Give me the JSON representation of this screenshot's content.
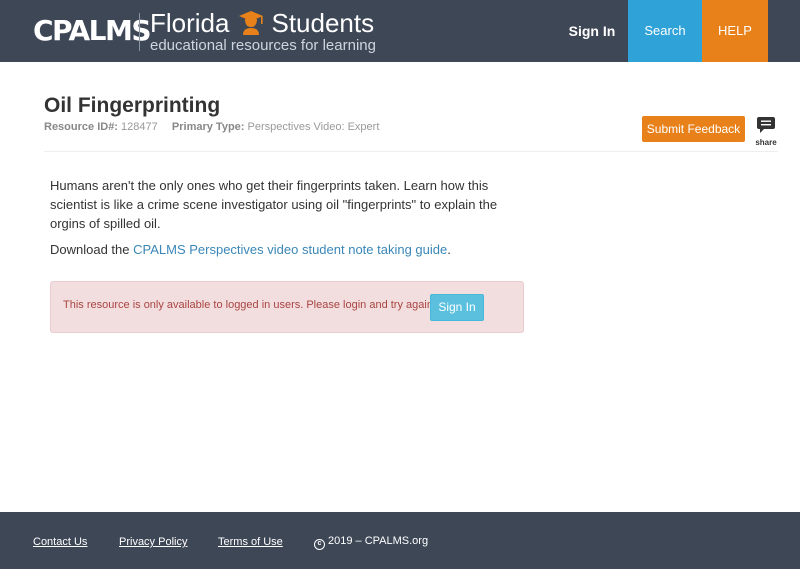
{
  "header": {
    "logo_text": "CPALMS",
    "brand_title_left": "Florida",
    "brand_title_right": "Students",
    "brand_subtitle": "educational resources for learning",
    "nav": {
      "sign_in": "Sign In",
      "search": "Search",
      "help": "HELP"
    }
  },
  "resource": {
    "title": "Oil Fingerprinting",
    "id_label": "Resource ID#:",
    "id_value": "128477",
    "type_label": "Primary Type:",
    "type_value": "Perspectives Video: Expert",
    "feedback_button": "Submit Feedback",
    "share_label": "share",
    "description": "Humans aren't the only ones who get their fingerprints taken. Learn how this scientist is like a crime scene investigator using oil \"fingerprints\" to explain the orgins of spilled oil.",
    "download_prefix": "Download the ",
    "download_link": "CPALMS Perspectives video student note taking guide",
    "download_suffix": "."
  },
  "alert": {
    "message": "This resource is only available to logged in users. Please login and try again.",
    "button": "Sign In"
  },
  "footer": {
    "contact": "Contact Us",
    "privacy": "Privacy Policy",
    "terms": "Terms of Use",
    "copyright": "2019 – CPALMS.org"
  },
  "colors": {
    "header_bg": "#3e4756",
    "search_bg": "#2fa2d8",
    "help_bg": "#e8811a",
    "feedback_bg": "#e8811a",
    "link": "#3a87b8",
    "alert_bg": "#f2dede",
    "alert_text": "#a94442",
    "alert_button": "#5bc0de"
  },
  "icons": {
    "brand": "student-silhouette-icon",
    "share": "speech-bubble-icon",
    "copyright": "copyright-icon"
  }
}
